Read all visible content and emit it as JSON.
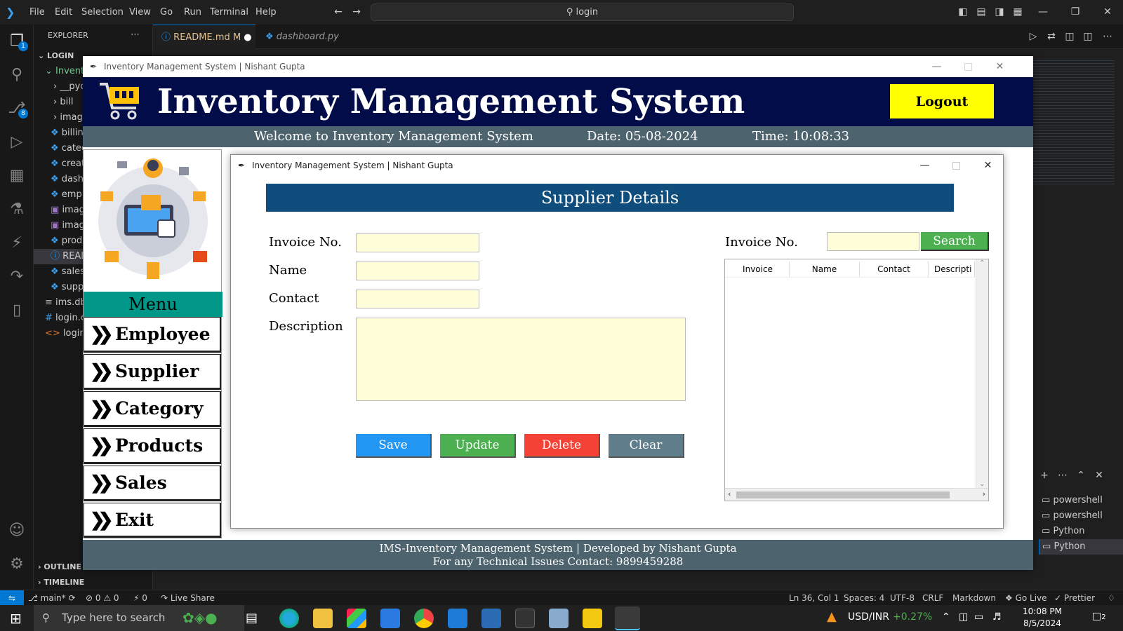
{
  "vscode": {
    "menu": [
      "File",
      "Edit",
      "Selection",
      "View",
      "Go",
      "Run",
      "Terminal",
      "Help"
    ],
    "search": "login",
    "explorer_title": "EXPLORER",
    "folder": "LOGIN",
    "tree": [
      "Invent",
      "__pyc",
      "bill",
      "imag",
      "billin",
      "categ",
      "creat",
      "dash",
      "empl",
      "imag",
      "imag",
      "prod",
      "READ",
      "sales",
      "supp",
      "ims.db",
      "login.c",
      "login.h"
    ],
    "outline": "OUTLINE",
    "timeline": "TIMELINE",
    "tabs": [
      {
        "label": "README.md",
        "suffix": "M"
      },
      {
        "label": "dashboard.py",
        "suffix": ""
      }
    ],
    "explorer_badge": "1",
    "scm_badge": "8",
    "terminals": [
      "powershell",
      "powershell",
      "Python",
      "Python"
    ],
    "status": {
      "branch": "main*",
      "errors": "0",
      "warnings": "0",
      "ports": "0",
      "live_share": "Live Share",
      "position": "Ln 36, Col 1",
      "spaces": "Spaces: 4",
      "encoding": "UTF-8",
      "eol": "CRLF",
      "language": "Markdown",
      "go_live": "Go Live",
      "prettier": "Prettier"
    }
  },
  "taskbar": {
    "search_placeholder": "Type here to search",
    "ticker": "USD/INR",
    "ticker_change": "+0.27%",
    "time": "10:08 PM",
    "date": "8/5/2024",
    "notif": "2"
  },
  "app": {
    "window_title": "Inventory Management System | Nishant Gupta",
    "title": "Inventory Management System",
    "logout": "Logout",
    "welcome": "Welcome to Inventory Management System",
    "date": "Date: 05-08-2024",
    "time": "Time: 10:08:33",
    "menu_title": "Menu",
    "menu": [
      "Employee",
      "Supplier",
      "Category",
      "Products",
      "Sales",
      "Exit"
    ],
    "footer_line1": "IMS-Inventory Management System | Developed by Nishant Gupta",
    "footer_line2": "For any Technical Issues Contact: 9899459288"
  },
  "supplier": {
    "window_title": "Inventory Management System | Nishant Gupta",
    "header": "Supplier Details",
    "labels": {
      "invoice": "Invoice No.",
      "name": "Name",
      "contact": "Contact",
      "description": "Description",
      "search_invoice": "Invoice No."
    },
    "values": {
      "invoice": "",
      "name": "",
      "contact": "",
      "description": "",
      "search": ""
    },
    "buttons": {
      "save": "Save",
      "update": "Update",
      "delete": "Delete",
      "clear": "Clear",
      "search": "Search"
    },
    "columns": [
      "Invoice",
      "Name",
      "Contact",
      "Descripti"
    ],
    "colors": {
      "save": "#2196f3",
      "update": "#4caf50",
      "delete": "#f44336",
      "clear": "#607d8b"
    }
  }
}
